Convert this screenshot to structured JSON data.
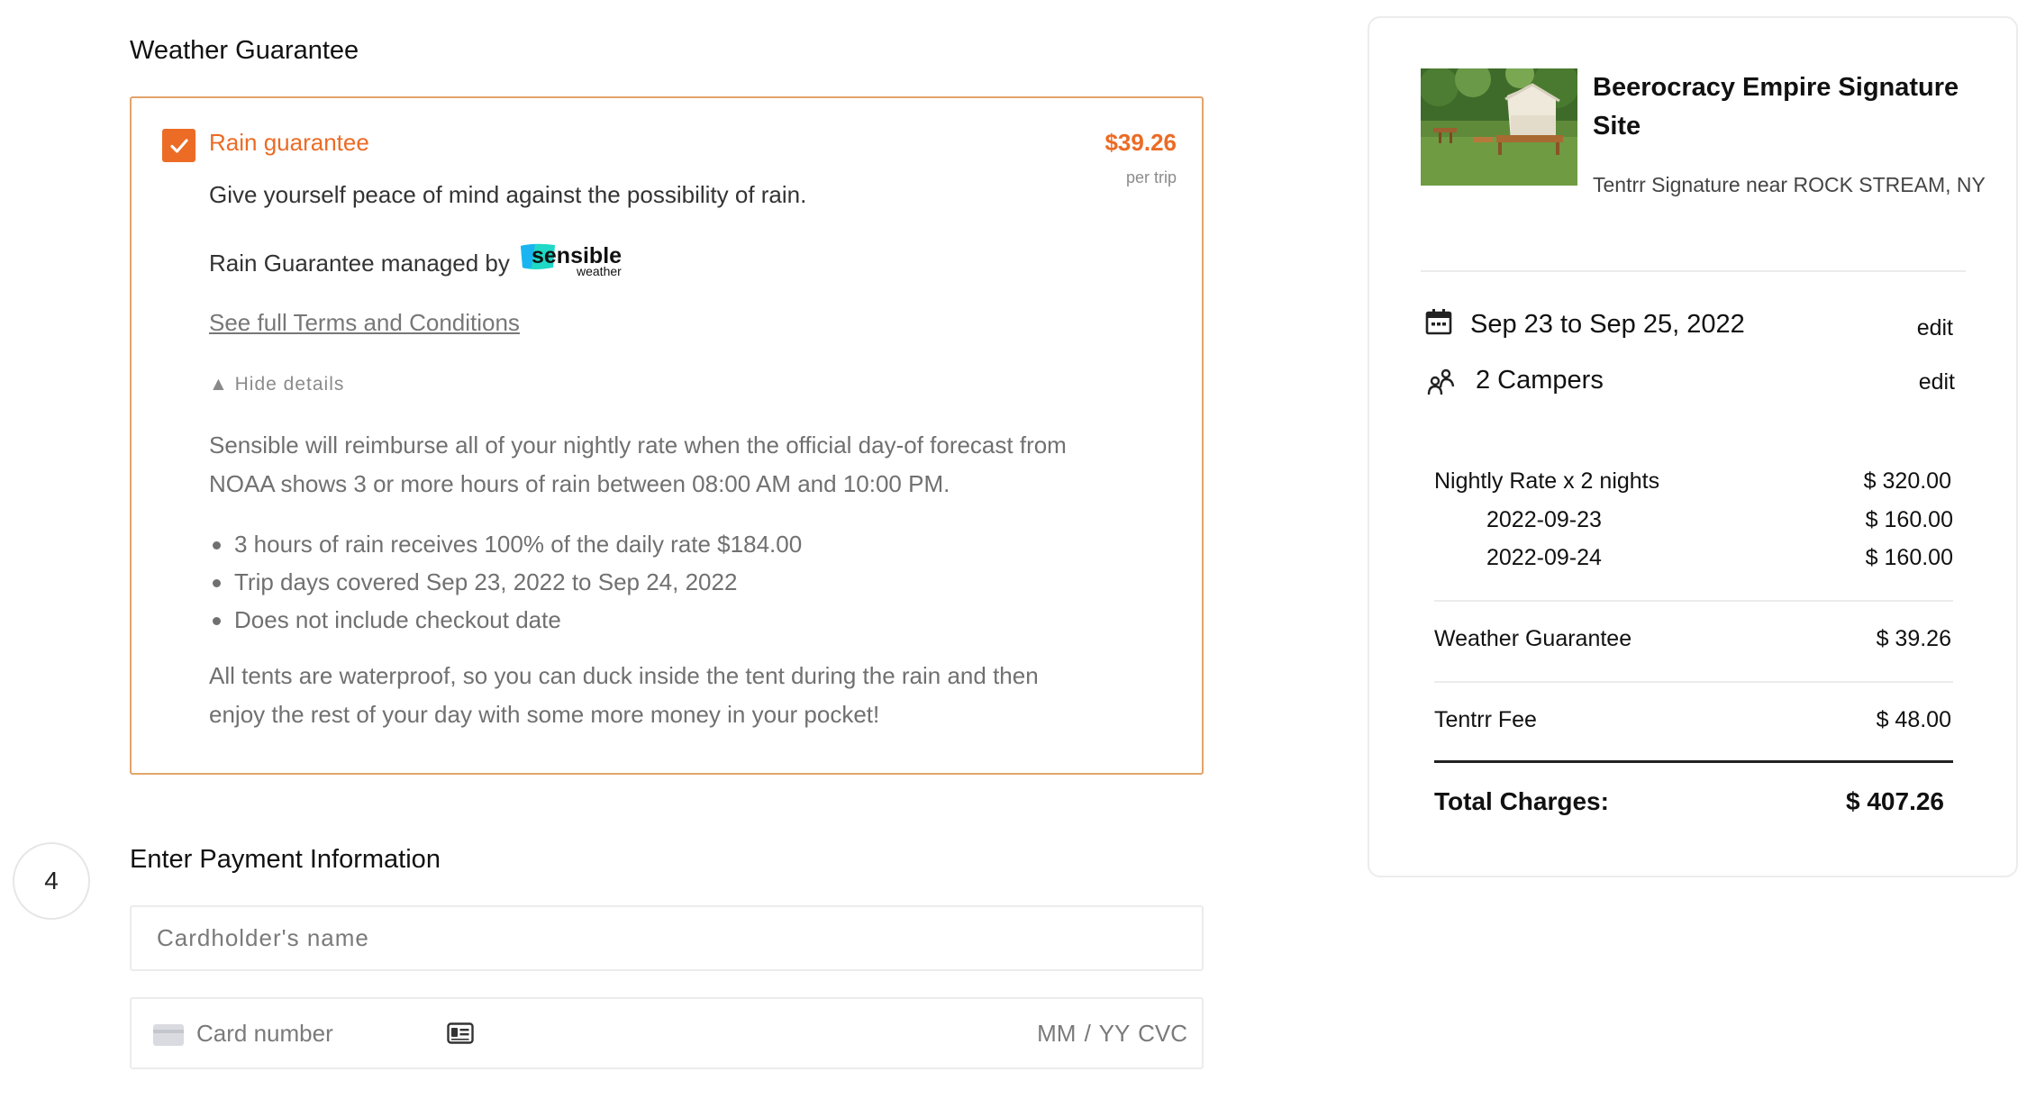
{
  "weather_section": {
    "title": "Weather Guarantee",
    "option": {
      "title": "Rain guarantee",
      "checked": true,
      "price": "$39.26",
      "price_unit": "per trip",
      "description": "Give yourself peace of mind against the possibility of rain.",
      "managed_by": "Rain Guarantee managed by",
      "partner_logo": {
        "name": "sensible",
        "sub": "weather"
      },
      "terms_link": "See full Terms and Conditions",
      "hide_details": "Hide details",
      "details": "Sensible will reimburse all of your nightly rate when the official day-of forecast from NOAA shows 3 or more hours of rain between 08:00 AM  and 10:00 PM.",
      "bullets": [
        "3 hours of rain receives 100% of the daily rate $184.00",
        "Trip days covered Sep 23, 2022 to Sep 24, 2022",
        "Does not include checkout date"
      ],
      "footer": "All tents are waterproof, so you can duck inside the tent during the rain and then enjoy the rest of your day with some more money in your pocket!"
    },
    "accent_color": "#ec6b25"
  },
  "payment_section": {
    "step_number": "4",
    "title": "Enter Payment Information",
    "cardholder_placeholder": "Cardholder's name",
    "card_number_placeholder": "Card number",
    "expiry_cvc_placeholder": "MM / YY  CVC"
  },
  "summary": {
    "site_name": "Beerocracy Empire Signature Site",
    "site_subtitle": "Tentrr Signature near ROCK STREAM, NY",
    "dates": "Sep 23 to Sep 25, 2022",
    "dates_edit": "edit",
    "campers": "2 Campers",
    "campers_edit": "edit",
    "nightly_label": "Nightly Rate x 2 nights",
    "nightly_amount": "$ 320.00",
    "nights": [
      {
        "date": "2022-09-23",
        "amount": "$ 160.00"
      },
      {
        "date": "2022-09-24",
        "amount": "$ 160.00"
      }
    ],
    "weather_label": "Weather Guarantee",
    "weather_amount": "$ 39.26",
    "fee_label": "Tentrr Fee",
    "fee_amount": "$ 48.00",
    "total_label": "Total Charges:",
    "total_amount": "$ 407.26"
  }
}
